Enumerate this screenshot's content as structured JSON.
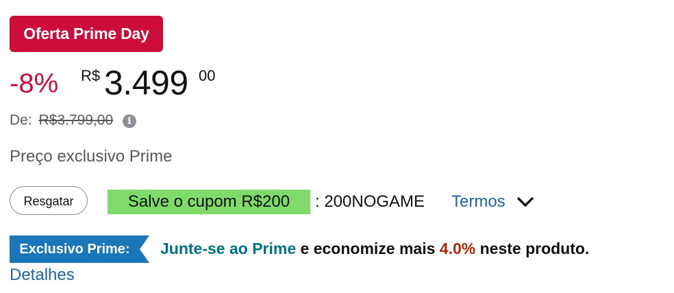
{
  "deal_badge": {
    "label": "Oferta Prime Day",
    "color": "#cc0c39"
  },
  "price": {
    "discount": "-8%",
    "currency": "R$",
    "whole": "3.499",
    "fraction": "00"
  },
  "list_price": {
    "label": "De:",
    "value": "R$3.799,00",
    "icon": "info-icon"
  },
  "prime_exclusive_text": "Preço exclusivo Prime",
  "coupon": {
    "redeem_label": "Resgatar",
    "badge_text": "Salve o cupom R$200",
    "badge_color": "#7fda69",
    "code_text": ": 200NOGAME",
    "terms_label": "Termos",
    "terms_icon": "chevron-down-icon"
  },
  "prime_offer": {
    "tag_label": "Exclusivo Prime:",
    "tag_color": "#1a76b8",
    "join_link": "Junte-se ao Prime",
    "text_before": " e economize mais ",
    "percent": "4.0%",
    "text_after": " neste produto.",
    "details_link": "Detalhes"
  }
}
